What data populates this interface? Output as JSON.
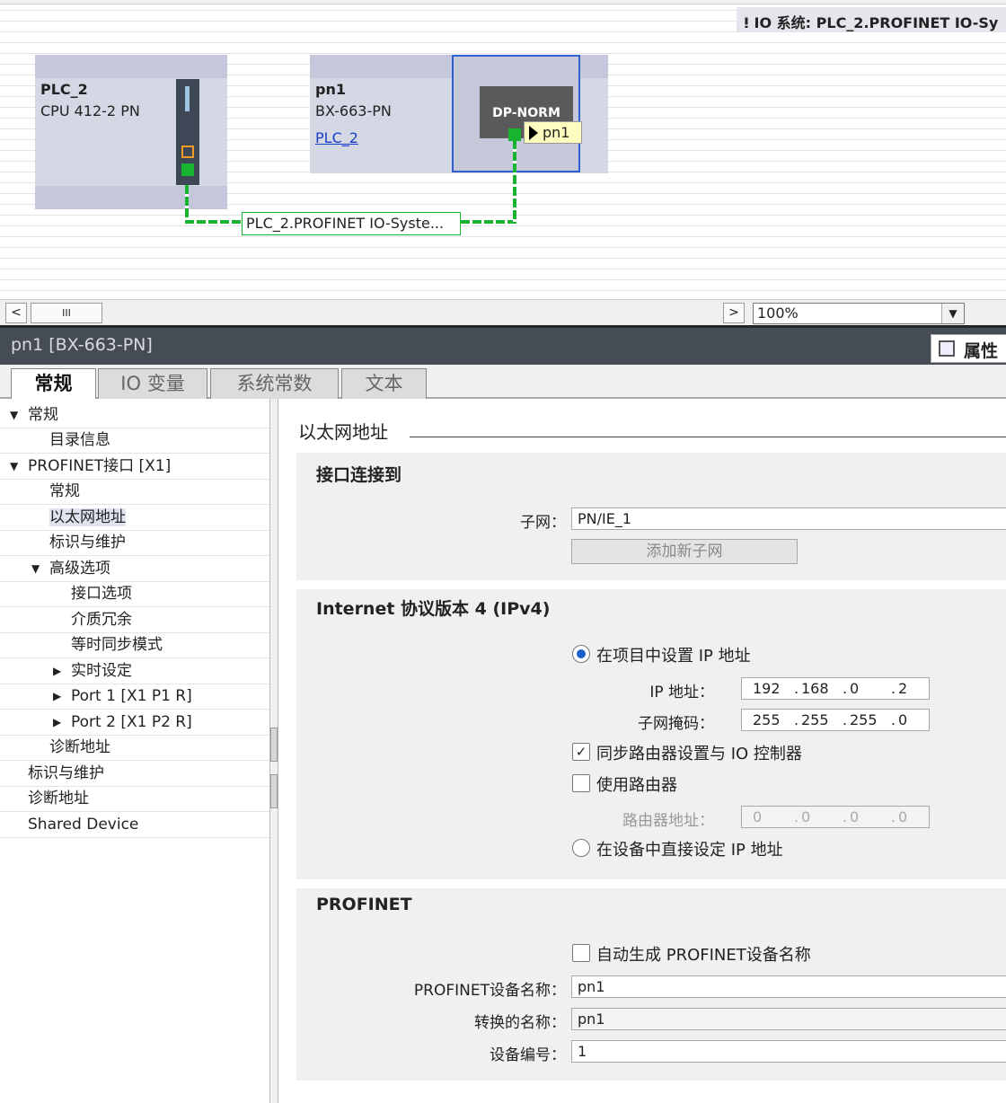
{
  "network": {
    "io_system_banner": "IO 系统: PLC_2.PROFINET IO-Sy",
    "pin_icon": "pin-icon",
    "devices": [
      {
        "name": "PLC_2",
        "type": "CPU 412-2 PN"
      },
      {
        "name": "pn1",
        "type": "BX-663-PN",
        "link": "PLC_2"
      }
    ],
    "module_label": "DP-NORM",
    "port_tooltip": "pn1",
    "subnet_label": "PLC_2.PROFINET IO-Syste..."
  },
  "scrollbar": {
    "left_arrow": "<",
    "thumb": "III",
    "right_arrow": ">",
    "zoom": "100%",
    "dropdown_arrow": "▼"
  },
  "inspector": {
    "title": "pn1 [BX-663-PN]",
    "properties_label": "属性",
    "tabs": [
      "常规",
      "IO 变量",
      "系统常数",
      "文本"
    ],
    "active_tab": "常规"
  },
  "nav": {
    "items": [
      {
        "label": "常规",
        "expanded": true
      },
      {
        "label": "目录信息"
      },
      {
        "label": "PROFINET接口 [X1]",
        "expanded": true
      },
      {
        "label": "常规"
      },
      {
        "label": "以太网地址",
        "selected": true
      },
      {
        "label": "标识与维护"
      },
      {
        "label": "高级选项",
        "expanded": true
      },
      {
        "label": "接口选项"
      },
      {
        "label": "介质冗余"
      },
      {
        "label": "等时同步模式"
      },
      {
        "label": "实时设定",
        "expanded": false
      },
      {
        "label": "Port 1 [X1 P1 R]",
        "expanded": false
      },
      {
        "label": "Port 2 [X1 P2 R]",
        "expanded": false
      },
      {
        "label": "诊断地址"
      },
      {
        "label": "标识与维护"
      },
      {
        "label": "诊断地址"
      },
      {
        "label": "Shared Device"
      }
    ]
  },
  "ethernet": {
    "section_title": "以太网地址",
    "interface": {
      "heading": "接口连接到",
      "subnet_label": "子网：",
      "subnet_value": "PN/IE_1",
      "add_subnet_button": "添加新子网"
    },
    "ipv4": {
      "heading": "Internet 协议版本 4 (IPv4)",
      "set_in_project_label": "在项目中设置 IP 地址",
      "set_in_project": true,
      "ip_label": "IP 地址：",
      "ip": [
        "192",
        "168",
        "0",
        "2"
      ],
      "mask_label": "子网掩码：",
      "mask": [
        "255",
        "255",
        "255",
        "0"
      ],
      "sync_router_label": "同步路由器设置与 IO 控制器",
      "sync_router": true,
      "use_router_label": "使用路由器",
      "use_router": false,
      "router_label": "路由器地址：",
      "router": [
        "0",
        "0",
        "0",
        "0"
      ],
      "set_on_device_label": "在设备中直接设定 IP 地址",
      "set_on_device": false
    },
    "profinet": {
      "heading": "PROFINET",
      "auto_name_label": "自动生成 PROFINET设备名称",
      "auto_name": false,
      "device_name_label": "PROFINET设备名称：",
      "device_name": "pn1",
      "converted_name_label": "转换的名称：",
      "converted_name": "pn1",
      "device_number_label": "设备编号：",
      "device_number": "1"
    }
  },
  "colors": {
    "network_green": "#17b331",
    "selection_blue": "#2f5fd0",
    "header_bg": "#464c54",
    "device_bg": "#d4d7e4"
  }
}
